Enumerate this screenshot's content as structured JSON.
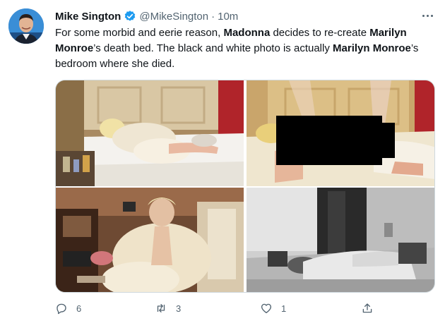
{
  "author": {
    "name": "Mike Sington",
    "handle": "@MikeSington",
    "separator": "·",
    "time": "10m",
    "verified": true
  },
  "tweet": {
    "text_parts": [
      {
        "t": "For some morbid and eerie reason, ",
        "bold": false
      },
      {
        "t": "Madonna",
        "bold": true
      },
      {
        "t": " decides to re-create ",
        "bold": false
      },
      {
        "t": "Marilyn Monroe",
        "bold": true
      },
      {
        "t": "’s death bed. The black and white photo is actually ",
        "bold": false
      },
      {
        "t": "Marilyn Monroe",
        "bold": true
      },
      {
        "t": "’s bedroom where she died.",
        "bold": false
      }
    ]
  },
  "media": {
    "photos": [
      {
        "name": "madonna-bed-photo",
        "icon": "photo"
      },
      {
        "name": "bedroom-censored-photo",
        "icon": "photo"
      },
      {
        "name": "madonna-fur-photo",
        "icon": "photo"
      },
      {
        "name": "monroe-bedroom-bw-photo",
        "icon": "photo"
      }
    ]
  },
  "actions": {
    "reply_count": "6",
    "retweet_count": "3",
    "like_count": "1"
  },
  "colors": {
    "verified": "#1d9bf0",
    "secondary_text": "#536471",
    "border": "#cfd9de"
  }
}
